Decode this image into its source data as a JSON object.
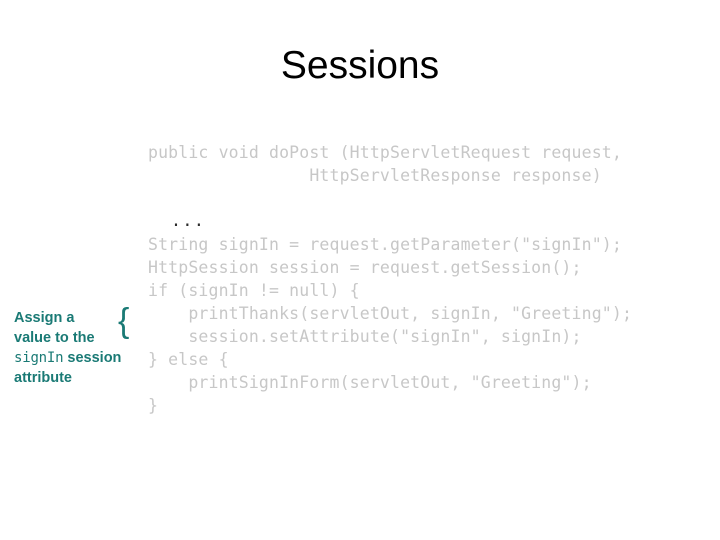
{
  "slide": {
    "title": "Sessions",
    "background_color": "#ffffff"
  },
  "code": {
    "text_color": "#c7c7c7",
    "ellipsis_color": "#2b2b2b",
    "lines": [
      "public void doPost (HttpServletRequest request,",
      "                HttpServletResponse response)",
      "",
      "  ...",
      "String signIn = request.getParameter(\"signIn\");",
      "HttpSession session = request.getSession();",
      "if (signIn != null) {",
      "    printThanks(servletOut, signIn, \"Greeting\");",
      "    session.setAttribute(\"signIn\", signIn);",
      "} else {",
      "    printSignInForm(servletOut, \"Greeting\");",
      "}"
    ]
  },
  "annotation": {
    "color": "#1a7a75",
    "pointer_brace": "{",
    "line1": "Assign a",
    "line2": "value to the",
    "line3_mono": "signIn",
    "line3_bold": " session",
    "line4": "attribute"
  }
}
